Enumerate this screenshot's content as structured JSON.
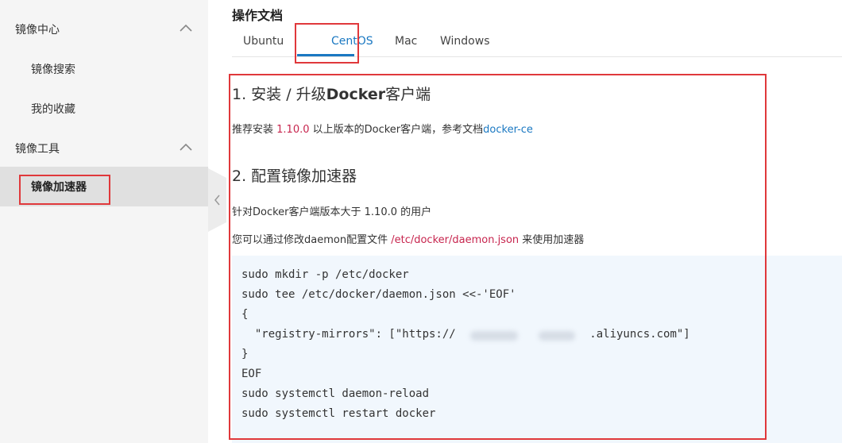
{
  "sidebar": {
    "group1": {
      "label": "镜像中心",
      "icon": "chevron-up-icon"
    },
    "items1": [
      {
        "label": "镜像搜索"
      },
      {
        "label": "我的收藏"
      }
    ],
    "group2": {
      "label": "镜像工具",
      "icon": "chevron-up-icon"
    },
    "active_item": {
      "label": "镜像加速器"
    },
    "collapse_icon": "chevron-left-icon"
  },
  "main": {
    "title": "操作文档",
    "tabs": [
      {
        "label": "Ubuntu"
      },
      {
        "label": "CentOS",
        "active": true
      },
      {
        "label": "Mac"
      },
      {
        "label": "Windows"
      }
    ],
    "section1": {
      "heading_prefix": "1. 安装 / 升级",
      "heading_bold": "Docker",
      "heading_suffix": "客户端",
      "text_before": "推荐安装 ",
      "version": "1.10.0",
      "text_middle": " 以上版本的Docker客户端，参考文档",
      "link": "docker-ce"
    },
    "section2": {
      "heading": "2. 配置镜像加速器",
      "line1": "针对Docker客户端版本大于 1.10.0 的用户",
      "line2_before": "您可以通过修改daemon配置文件 ",
      "config_path": "/etc/docker/daemon.json",
      "line2_after": " 来使用加速器"
    },
    "code": [
      "sudo mkdir -p /etc/docker",
      "sudo tee /etc/docker/daemon.json <<-'EOF'",
      "{",
      "  \"registry-mirrors\": [\"https://                    .aliyuncs.com\"]",
      "}",
      "EOF",
      "sudo systemctl daemon-reload",
      "sudo systemctl restart docker"
    ]
  },
  "colors": {
    "accent": "#1a78c2",
    "highlight_box": "#e0383b",
    "code_inline": "#c7254e",
    "code_bg": "#f1f7fd",
    "sidebar_bg": "#f5f5f5"
  }
}
